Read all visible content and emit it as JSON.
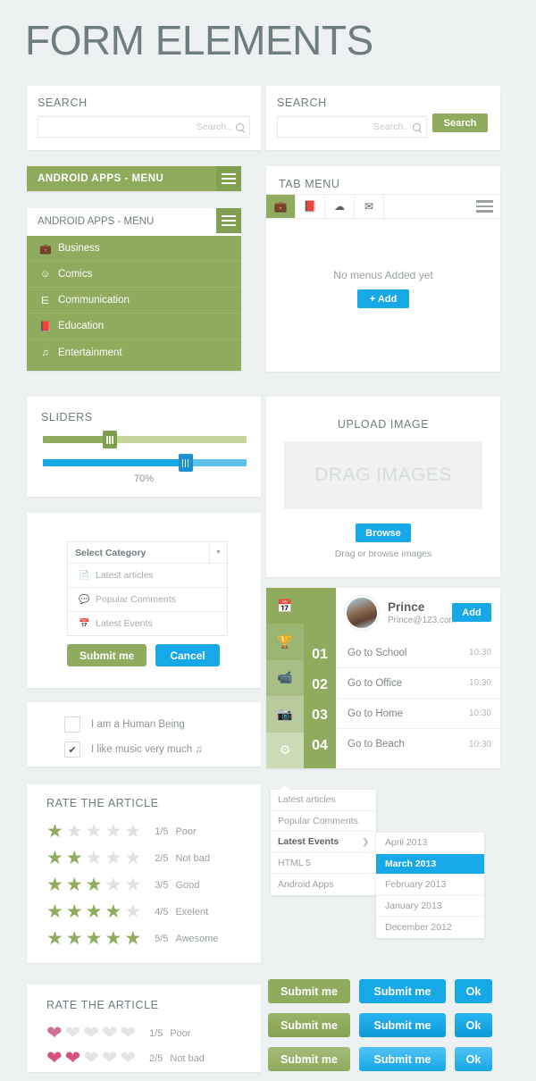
{
  "page": {
    "title": "FORM ELEMENTS",
    "bg_color": "#eef1f1",
    "green": "#8fab5e",
    "blue": "#17a8e8",
    "title_color": "#6e7d80"
  },
  "search_simple": {
    "title": "SEARCH",
    "placeholder": "Search..",
    "value": ""
  },
  "search_button": {
    "title": "SEARCH",
    "placeholder": "Search..",
    "value": "",
    "button_label": "Search"
  },
  "android_bar": {
    "title": "ANDROID APPS - MENU"
  },
  "android_menu": {
    "title": "ANDROID APPS - MENU",
    "items": [
      {
        "label": "Business",
        "icon": "briefcase-icon",
        "glyph": "ὋC"
      },
      {
        "label": "Comics",
        "icon": "smiley-icon",
        "glyph": "☺"
      },
      {
        "label": "Communication",
        "icon": "laptop-icon",
        "glyph": "⌸"
      },
      {
        "label": "Education",
        "icon": "book-icon",
        "glyph": "Ὅ5"
      },
      {
        "label": "Entertainment",
        "icon": "music-note-icon",
        "glyph": "♫"
      }
    ]
  },
  "tab_menu": {
    "title": "TAB MENU",
    "tabs": [
      {
        "icon": "briefcase-icon",
        "glyph": "ὋC",
        "active": true
      },
      {
        "icon": "book-icon",
        "glyph": "Ὅ5",
        "active": false
      },
      {
        "icon": "cloud-upload-icon",
        "glyph": "☁",
        "active": false
      },
      {
        "icon": "envelope-icon",
        "glyph": "✉",
        "active": false
      }
    ],
    "empty_message": "No menus Added yet",
    "add_label": "+  Add"
  },
  "sliders": {
    "title": "SLIDERS",
    "green_value": 33,
    "blue_value": 70,
    "value_label": "70%"
  },
  "upload": {
    "title": "UPLOAD IMAGE",
    "dropzone_label": "DRAG IMAGES",
    "browse_label": "Browse",
    "hint": "Drag or browse images"
  },
  "select_panel": {
    "selected": "Select Category",
    "options": [
      {
        "label": "Latest articles",
        "icon": "file-icon",
        "glyph": "Ὄ4"
      },
      {
        "label": "Popular Comments",
        "icon": "comment-icon",
        "glyph": "ὊC"
      },
      {
        "label": "Latest Events",
        "icon": "calendar-icon",
        "glyph": "Ὄ5"
      }
    ],
    "submit_label": "Submit me",
    "cancel_label": "Cancel"
  },
  "checkboxes": [
    {
      "label": "I am a Human Being",
      "checked": false
    },
    {
      "label": "I like music very much ♫",
      "checked": true
    }
  ],
  "profile": {
    "name": "Prince",
    "email": "Prince@123.com",
    "add_label": "Add",
    "sidebar_icons": [
      {
        "icon": "calendar-icon",
        "glyph": "Ὄ5",
        "color": "#8fab5e"
      },
      {
        "icon": "trophy-icon",
        "glyph": "Ἴ6",
        "color": "#9ab571"
      },
      {
        "icon": "video-camera-icon",
        "glyph": "὏9",
        "color": "#a7be84"
      },
      {
        "icon": "camera-icon",
        "glyph": "὏7",
        "color": "#b8cb9d"
      },
      {
        "icon": "gear-icon",
        "glyph": "⚙",
        "color": "#cadbb6"
      }
    ],
    "todos": [
      {
        "num": "01",
        "text": "Go to School",
        "time": "10:30"
      },
      {
        "num": "02",
        "text": "Go to Office",
        "time": "10:30"
      },
      {
        "num": "03",
        "text": "Go to Home",
        "time": "10:30"
      },
      {
        "num": "04",
        "text": "Go to Beach",
        "time": "10:30"
      }
    ]
  },
  "star_rating": {
    "title": "RATE THE ARTICLE",
    "rows": [
      {
        "filled": 1,
        "score": "1/5",
        "label": "Poor"
      },
      {
        "filled": 2,
        "score": "2/5",
        "label": "Not bad"
      },
      {
        "filled": 3,
        "score": "3/5",
        "label": "Good"
      },
      {
        "filled": 4,
        "score": "4/5",
        "label": "Exelent"
      },
      {
        "filled": 5,
        "score": "5/5",
        "label": "Awesome"
      }
    ]
  },
  "heart_rating": {
    "title": "RATE THE ARTICLE",
    "rows": [
      {
        "filled": 1,
        "score": "1/5",
        "label": "Poor"
      },
      {
        "filled": 2,
        "score": "2/5",
        "label": "Not bad"
      }
    ]
  },
  "cascade_menu": {
    "items": [
      {
        "label": "Latest articles",
        "selected": false,
        "has_sub": false
      },
      {
        "label": "Popular Comments",
        "selected": false,
        "has_sub": false
      },
      {
        "label": "Latest Events",
        "selected": true,
        "has_sub": true
      },
      {
        "label": "HTML 5",
        "selected": false,
        "has_sub": false
      },
      {
        "label": "Android Apps",
        "selected": false,
        "has_sub": false
      }
    ],
    "submenu": [
      {
        "label": "April 2013",
        "highlighted": false
      },
      {
        "label": "March 2013",
        "highlighted": true
      },
      {
        "label": "February 2013",
        "highlighted": false
      },
      {
        "label": "January 2013",
        "highlighted": false
      },
      {
        "label": "December 2012",
        "highlighted": false
      }
    ]
  },
  "button_grid": {
    "rows": [
      {
        "submit": "Submit me",
        "submit_blue": "Submit me",
        "ok": "Ok"
      },
      {
        "submit": "Submit me",
        "submit_blue": "Submit me",
        "ok": "Ok"
      },
      {
        "submit": "Submit me",
        "submit_blue": "Submit me",
        "ok": "Ok"
      }
    ]
  }
}
